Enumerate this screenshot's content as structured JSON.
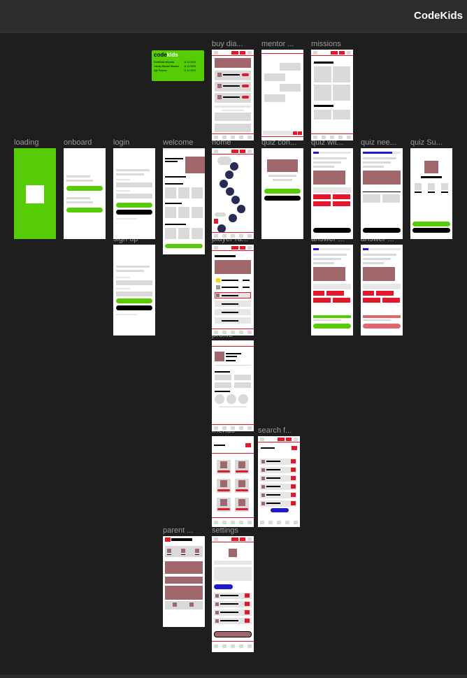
{
  "app": {
    "title": "CodeKids"
  },
  "colors": {
    "background": "#1e1e1e",
    "green": "#56cc04",
    "red": "#e4172b",
    "mauve": "#a0686a",
    "blue": "#1d1ace",
    "navy": "#252c56"
  },
  "frames": {
    "buy_diamonds": "buy dia...",
    "mentor": "mentor ...",
    "missions": "missions",
    "loading": "loading",
    "onboard": "onboard",
    "login": "login",
    "welcome": "welcome",
    "home": "home",
    "quiz_con": "quiz con...",
    "quiz_wit": "quiz wit...",
    "quiz_nee": "quiz nee...",
    "quiz_su": "quiz Su...",
    "sign_up": "sign up",
    "player_ranking": "player ra...",
    "answer_1": "answer ...",
    "answer_2": "answer ...",
    "profile": "profile",
    "friends": "friends",
    "search_f": "search f...",
    "parent": "parent ...",
    "settings": "settings"
  },
  "logo_card": {
    "logo_code": "code",
    "logo_kids": "kids",
    "rows": [
      {
        "left": "Sertifikatlı Müyəsis",
        "right": "11.11.2024"
      },
      {
        "left": "Yazılıq Əhmad Əlasanı",
        "right": "11.11.2024"
      },
      {
        "left": "Ağıl Suçusu",
        "right": "11.11.2024"
      }
    ]
  }
}
